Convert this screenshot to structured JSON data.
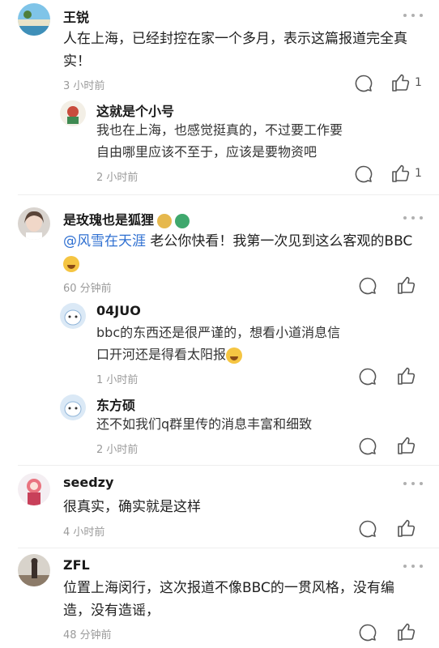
{
  "comments": [
    {
      "user": "王锐",
      "text": "人在上海，已经封控在家一个多月，表示这篇报道完全真实！",
      "time": "3 小时前",
      "likes": "1",
      "replies": [
        {
          "user": "这就是个小号",
          "text": "我也在上海，也感觉挺真的，不过要工作要自由哪里应该不至于，应该是要物资吧",
          "time": "2 小时前",
          "likes": "1"
        }
      ]
    },
    {
      "user": "是玫瑰也是狐狸",
      "mention": "@风雪在天涯",
      "text": " 老公你快看！我第一次见到这么客观的BBC",
      "time": "60 分钟前",
      "replies": [
        {
          "user": "04JUO",
          "text": "bbc的东西还是很严谨的，想看小道消息信口开河还是得看太阳报",
          "time": "1 小时前"
        },
        {
          "user": "东方硕",
          "text": "还不如我们q群里传的消息丰富和细致",
          "time": "2 小时前"
        }
      ]
    },
    {
      "user": "seedzy",
      "text": "很真实，确实就是这样",
      "time": "4 小时前"
    },
    {
      "user": "ZFL",
      "text": "位置上海闵行，这次报道不像BBC的一贯风格，没有编造，没有造谣，",
      "time": "48 分钟前"
    }
  ]
}
